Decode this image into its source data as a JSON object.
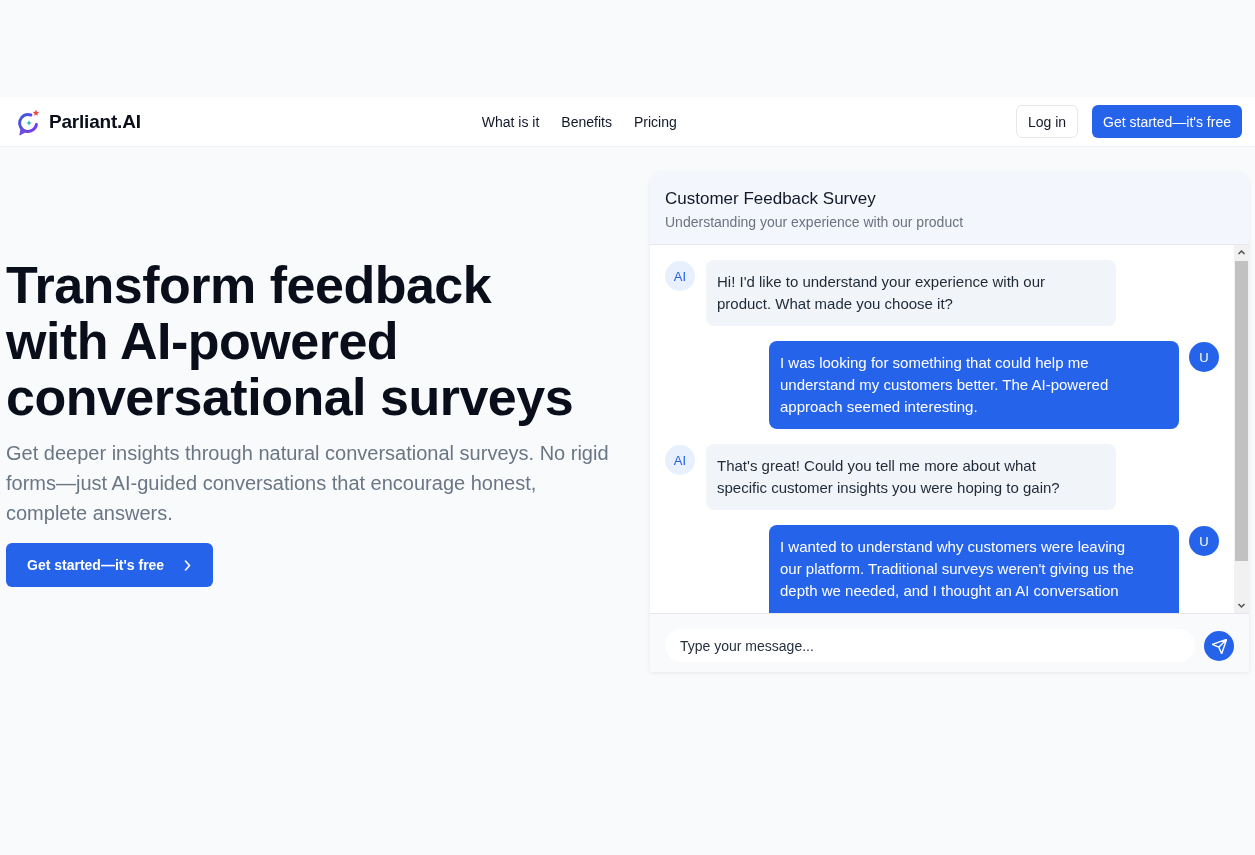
{
  "header": {
    "brand": "Parliant.AI",
    "nav": [
      "What is it",
      "Benefits",
      "Pricing"
    ],
    "login_button": "Log in",
    "cta_button": "Get started—it's free"
  },
  "hero": {
    "title": "Transform feedback with AI-powered conversational surveys",
    "subtitle": "Get deeper insights through natural conversational surveys. No rigid forms—just AI-guided conversations that encourage honest, complete answers.",
    "cta_button": "Get started—it's free"
  },
  "chat": {
    "title": "Customer Feedback Survey",
    "subtitle": "Understanding your experience with our product",
    "messages": [
      {
        "kind": "ai",
        "avatar": "AI",
        "text": "Hi! I'd like to understand your experience with our product. What made you choose it?"
      },
      {
        "kind": "user",
        "avatar": "U",
        "text": "I was looking for something that could help me understand my customers better. The AI-powered approach seemed interesting."
      },
      {
        "kind": "ai",
        "avatar": "AI",
        "text": "That's great! Could you tell me more about what specific customer insights you were hoping to gain?"
      },
      {
        "kind": "user",
        "avatar": "U",
        "text": "I wanted to understand why customers were leaving our platform. Traditional surveys weren't giving us the depth we needed, and I thought an AI conversation"
      }
    ],
    "input": {
      "placeholder": "Type your message..."
    }
  }
}
